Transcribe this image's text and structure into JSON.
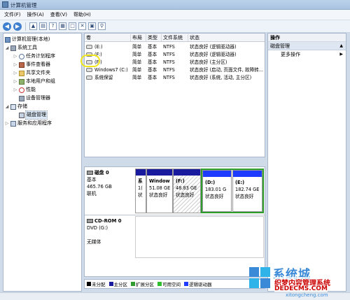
{
  "window": {
    "title": "计算机管理"
  },
  "menu": [
    "文件(F)",
    "操作(A)",
    "查看(V)",
    "帮助(H)"
  ],
  "nav": {
    "root": "计算机管理(本地)",
    "system_tools": "系统工具",
    "task_scheduler": "任务计划程序",
    "event_viewer": "事件查看器",
    "shared_folders": "共享文件夹",
    "local_users": "本地用户和组",
    "performance": "性能",
    "device_manager": "设备管理器",
    "storage": "存储",
    "disk_management": "磁盘管理",
    "services": "服务和应用程序"
  },
  "volumes": {
    "headers": [
      "卷",
      "布局",
      "类型",
      "文件系统",
      "状态"
    ],
    "rows": [
      {
        "name": "(E:)",
        "layout": "简单",
        "type": "基本",
        "fs": "NTFS",
        "status": "状态良好 (逻辑驱动器)"
      },
      {
        "name": "(F:)",
        "layout": "简单",
        "type": "基本",
        "fs": "NTFS",
        "status": "状态良好 (逻辑驱动器)"
      },
      {
        "name": "(F:)",
        "layout": "简单",
        "type": "基本",
        "fs": "NTFS",
        "status": "状态良好 (主分区)"
      },
      {
        "name": "Windows7 (C:)",
        "layout": "简单",
        "type": "基本",
        "fs": "NTFS",
        "status": "状态良好 (启动, 页面文件, 故障转..."
      },
      {
        "name": "系统保留",
        "layout": "简单",
        "type": "基本",
        "fs": "NTFS",
        "status": "状态良好 (系统, 活动, 主分区)"
      }
    ]
  },
  "disk0": {
    "name": "磁盘 0",
    "type": "基本",
    "size": "465.76 GB",
    "status": "联机",
    "partitions": [
      {
        "line1": "系",
        "line2": "1(",
        "line3": "状"
      },
      {
        "line1": "Window",
        "line2": "51.08 GE",
        "line3": "状态良好"
      },
      {
        "line1": "(F:)",
        "line2": "48.83 GE",
        "line3": "状态良好"
      },
      {
        "line1": "(D:)",
        "line2": "183.01 G",
        "line3": "状态良好"
      },
      {
        "line1": "(E:)",
        "line2": "182.74 GE",
        "line3": "状态良好"
      }
    ]
  },
  "cdrom": {
    "name": "CD-ROM 0",
    "type": "DVD (G:)",
    "status": "无媒体"
  },
  "legend": [
    "未分配",
    "主分区",
    "扩展分区",
    "可用空间",
    "逻辑驱动器"
  ],
  "colors": {
    "unallocated": "#000000",
    "primary": "#1a1a9e",
    "extended": "#2d9e2d",
    "free": "#2dbf2d",
    "logical": "#1e3cff"
  },
  "actions": {
    "header": "操作",
    "section": "磁盘管理",
    "more": "更多操作"
  },
  "watermark": {
    "brand": "系统城",
    "cn": "织梦内容管理系统",
    "en": "DEDECMS.COM",
    "url": "xitongcheng.com"
  }
}
